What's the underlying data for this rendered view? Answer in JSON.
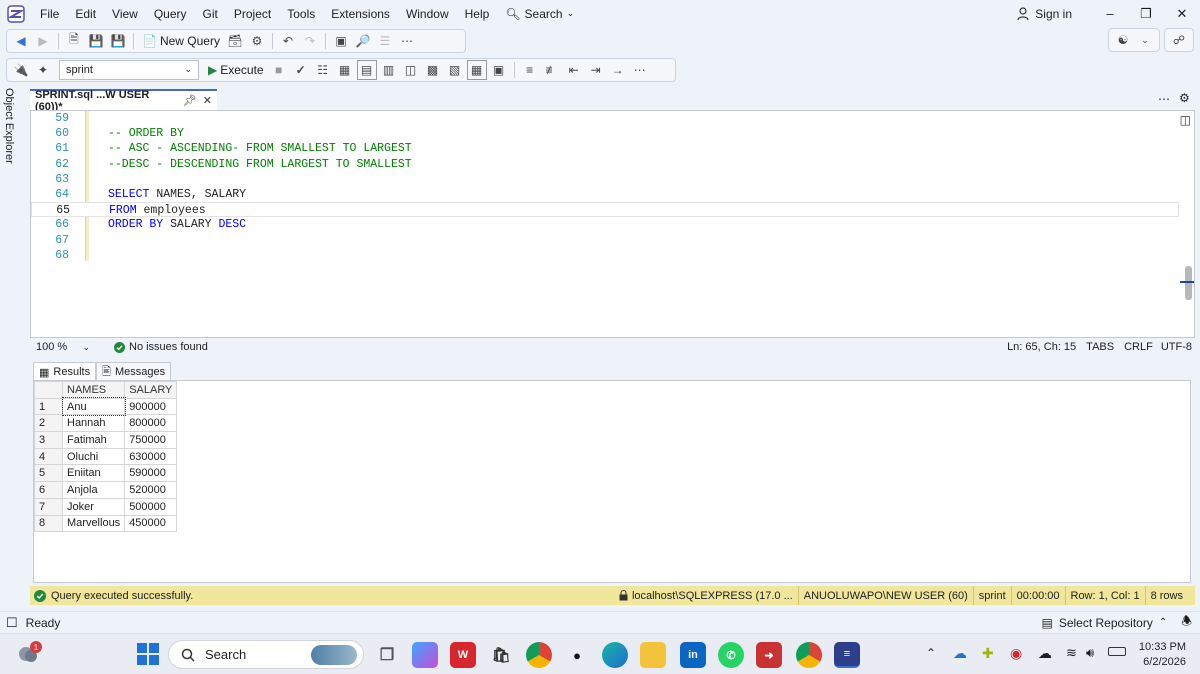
{
  "menu": {
    "items": [
      "File",
      "Edit",
      "View",
      "Query",
      "Git",
      "Project",
      "Tools",
      "Extensions",
      "Window",
      "Help"
    ],
    "search_label": "Search",
    "sign_in": "Sign in"
  },
  "toolbar": {
    "new_query": "New Query",
    "database": "sprint",
    "execute": "Execute"
  },
  "side": {
    "object_explorer": "Object Explorer"
  },
  "tab": {
    "title": "SPRINT.sql ...W USER (60))*"
  },
  "editor": {
    "lines": [
      {
        "num": "59",
        "parts": []
      },
      {
        "num": "60",
        "parts": [
          {
            "t": "-- ORDER BY",
            "c": "cm"
          }
        ]
      },
      {
        "num": "61",
        "parts": [
          {
            "t": "-- ASC - ASCENDING- FROM SMALLEST TO LARGEST",
            "c": "cm"
          }
        ]
      },
      {
        "num": "62",
        "parts": [
          {
            "t": "--DESC - DESCENDING FROM LARGEST TO SMALLEST",
            "c": "cm"
          }
        ]
      },
      {
        "num": "63",
        "parts": []
      },
      {
        "num": "64",
        "parts": [
          {
            "t": "SELECT",
            "c": "kw"
          },
          {
            "t": " NAMES, SALARY",
            "c": "tx"
          }
        ]
      },
      {
        "num": "65",
        "parts": [
          {
            "t": "FROM",
            "c": "kw"
          },
          {
            "t": " employees",
            "c": "tx"
          }
        ]
      },
      {
        "num": "66",
        "parts": [
          {
            "t": "ORDER BY",
            "c": "kw"
          },
          {
            "t": " SALARY ",
            "c": "tx"
          },
          {
            "t": "DESC",
            "c": "kw"
          }
        ]
      },
      {
        "num": "67",
        "parts": []
      },
      {
        "num": "68",
        "parts": []
      }
    ],
    "current_line": "65"
  },
  "editor_status": {
    "zoom": "100 %",
    "issues": "No issues found",
    "position": "Ln: 65, Ch: 15",
    "tabs": "TABS",
    "eol": "CRLF",
    "encoding": "UTF-8"
  },
  "results": {
    "tabs": [
      "Results",
      "Messages"
    ],
    "columns": [
      "NAMES",
      "SALARY"
    ],
    "rows": [
      [
        "1",
        "Anu",
        "900000"
      ],
      [
        "2",
        "Hannah",
        "800000"
      ],
      [
        "3",
        "Fatimah",
        "750000"
      ],
      [
        "4",
        "Oluchi",
        "630000"
      ],
      [
        "5",
        "Eniitan",
        "590000"
      ],
      [
        "6",
        "Anjola",
        "520000"
      ],
      [
        "7",
        "Joker",
        "500000"
      ],
      [
        "8",
        "Marvellous",
        "450000"
      ]
    ]
  },
  "query_status": {
    "message": "Query executed successfully.",
    "server": "localhost\\SQLEXPRESS (17.0 ...",
    "user": "ANUOLUWAPO\\NEW USER (60)",
    "database": "sprint",
    "elapsed": "00:00:00",
    "rowcol": "Row: 1, Col: 1",
    "rows": "8 rows"
  },
  "app_status": {
    "ready": "Ready",
    "repo": "Select Repository"
  },
  "taskbar": {
    "search": "Search",
    "badge": "1",
    "time": "10:33 PM",
    "date": "6/2/2026"
  },
  "colors": {
    "keyword": "#0000ff",
    "comment": "#008000",
    "line_number": "#2b91af",
    "status_yellow": "#f0e69c",
    "accent": "#4b66c7"
  }
}
